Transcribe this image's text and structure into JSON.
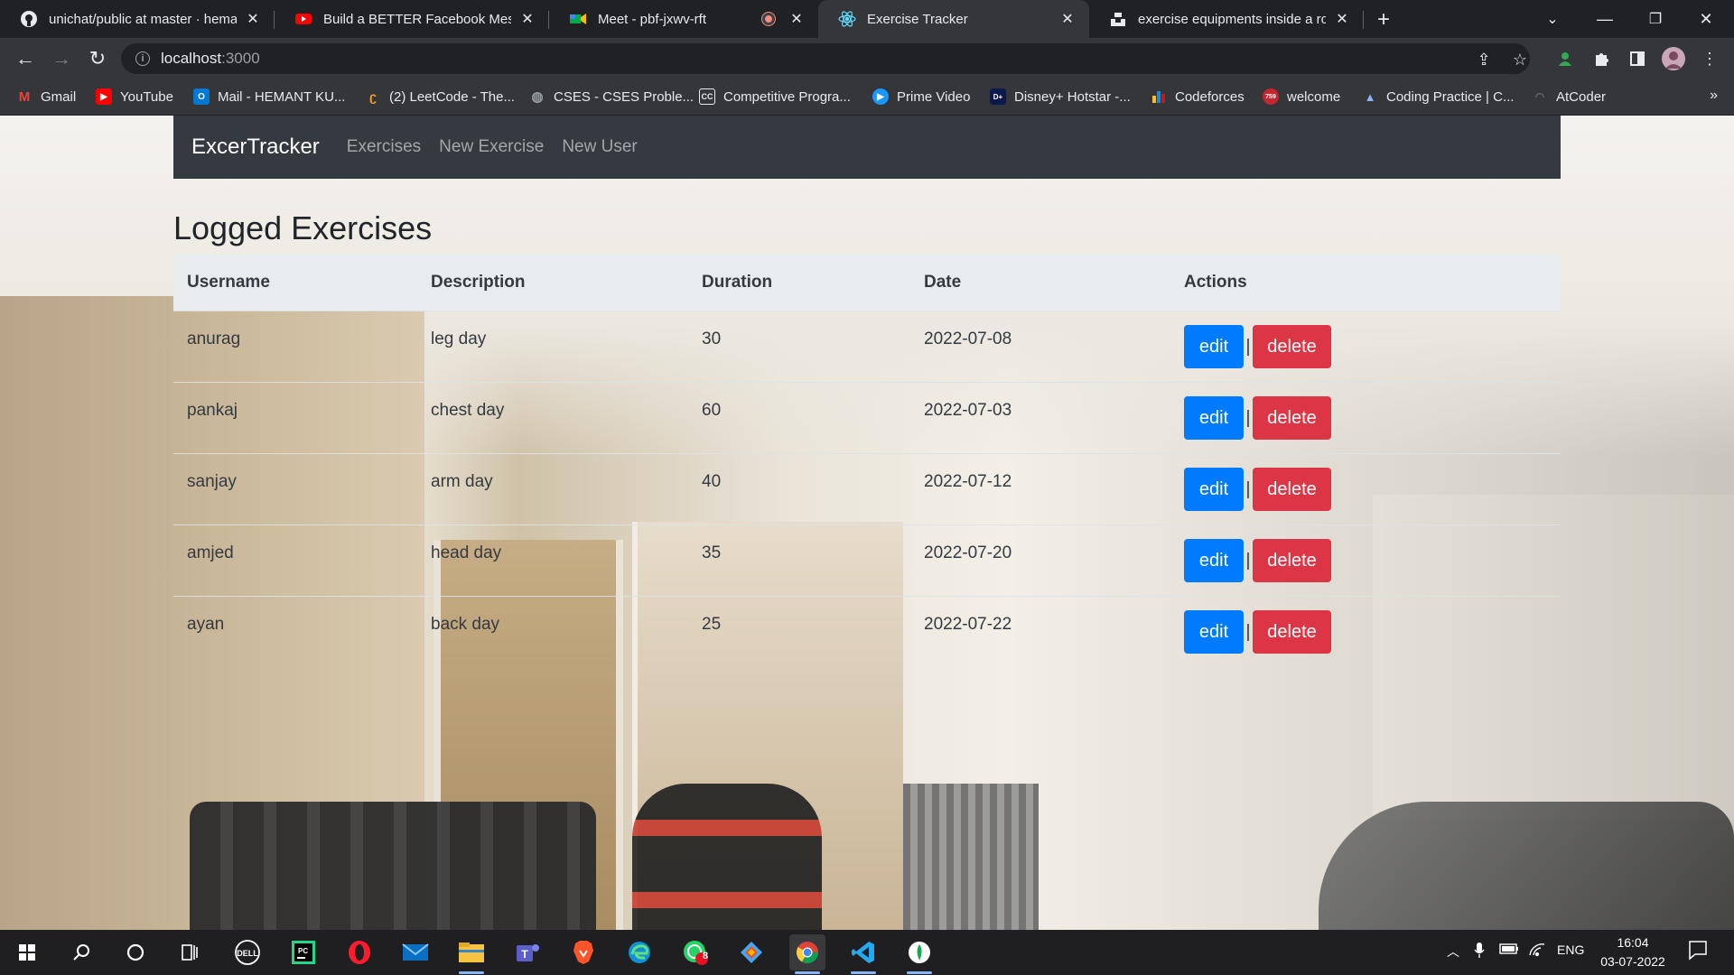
{
  "browser": {
    "tabs": [
      {
        "title": "unichat/public at master · heman",
        "icon": "github-icon"
      },
      {
        "title": "Build a BETTER Facebook Messen",
        "icon": "youtube-icon"
      },
      {
        "title": "Meet - pbf-jxwv-rft",
        "icon": "google-meet-icon"
      },
      {
        "title": "Exercise Tracker",
        "icon": "react-icon"
      },
      {
        "title": "exercise equipments inside a roo",
        "icon": "unsplash-icon"
      }
    ],
    "url_host": "localhost",
    "url_port": ":3000",
    "bookmarks": [
      {
        "label": "Gmail"
      },
      {
        "label": "YouTube"
      },
      {
        "label": "Mail - HEMANT KU..."
      },
      {
        "label": "(2) LeetCode - The..."
      },
      {
        "label": "CSES - CSES Proble..."
      },
      {
        "label": "Competitive Progra..."
      },
      {
        "label": "Prime Video"
      },
      {
        "label": "Disney+ Hotstar -..."
      },
      {
        "label": "Codeforces"
      },
      {
        "label": "welcome"
      },
      {
        "label": "Coding Practice | C..."
      },
      {
        "label": "AtCoder"
      }
    ],
    "more_bookmarks": "»"
  },
  "app": {
    "brand": "ExcerTracker",
    "nav": [
      "Exercises",
      "New Exercise",
      "New User"
    ],
    "page_title": "Logged Exercises",
    "columns": [
      "Username",
      "Description",
      "Duration",
      "Date",
      "Actions"
    ],
    "rows": [
      {
        "username": "anurag",
        "description": "leg day",
        "duration": "30",
        "date": "2022-07-08"
      },
      {
        "username": "pankaj",
        "description": "chest day",
        "duration": "60",
        "date": "2022-07-03"
      },
      {
        "username": "sanjay",
        "description": "arm day",
        "duration": "40",
        "date": "2022-07-12"
      },
      {
        "username": "amjed",
        "description": "head day",
        "duration": "35",
        "date": "2022-07-20"
      },
      {
        "username": "ayan",
        "description": "back day",
        "duration": "25",
        "date": "2022-07-22"
      }
    ],
    "edit_label": "edit",
    "separator": "|",
    "delete_label": "delete"
  },
  "taskbar": {
    "language": "ENG",
    "time": "16:04",
    "date": "03-07-2022",
    "whatsapp_badge": "8"
  },
  "colors": {
    "navbar": "#343a40",
    "edit_button": "#007bff",
    "delete_button": "#dc3545",
    "table_header": "#e9ecef"
  }
}
